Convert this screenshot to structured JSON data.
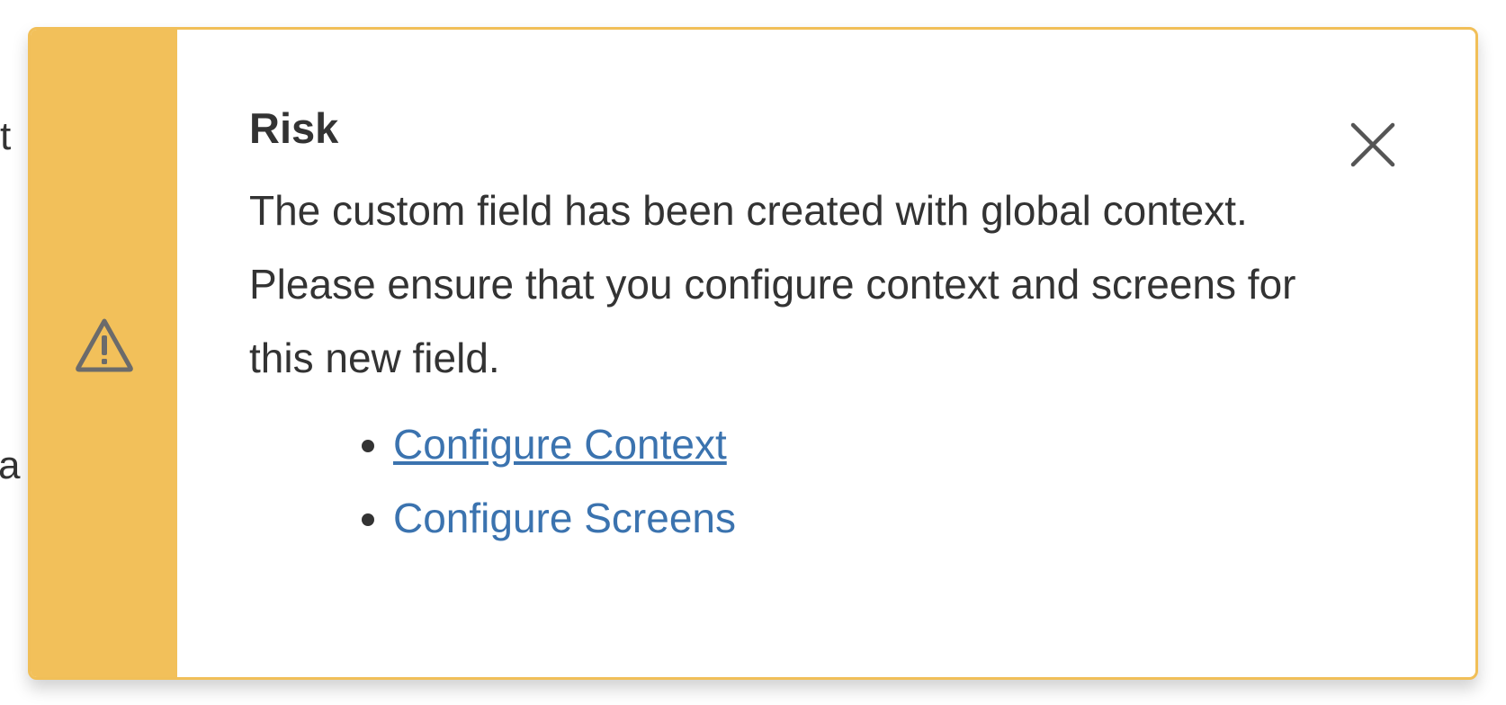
{
  "background": {
    "fragments": [
      "ılt",
      "a"
    ]
  },
  "flag": {
    "type": "warning",
    "accent_color": "#f2c05a",
    "icon": "warning-icon",
    "title": "Risk",
    "message": "The custom field has been created with global context. Please ensure that you configure context and screens for this new field.",
    "links": [
      {
        "label": "Configure Context",
        "state": "hovered-underlined"
      },
      {
        "label": "Configure Screens",
        "state": "default"
      }
    ],
    "close_icon": "close-icon",
    "link_color": "#3b73af"
  }
}
